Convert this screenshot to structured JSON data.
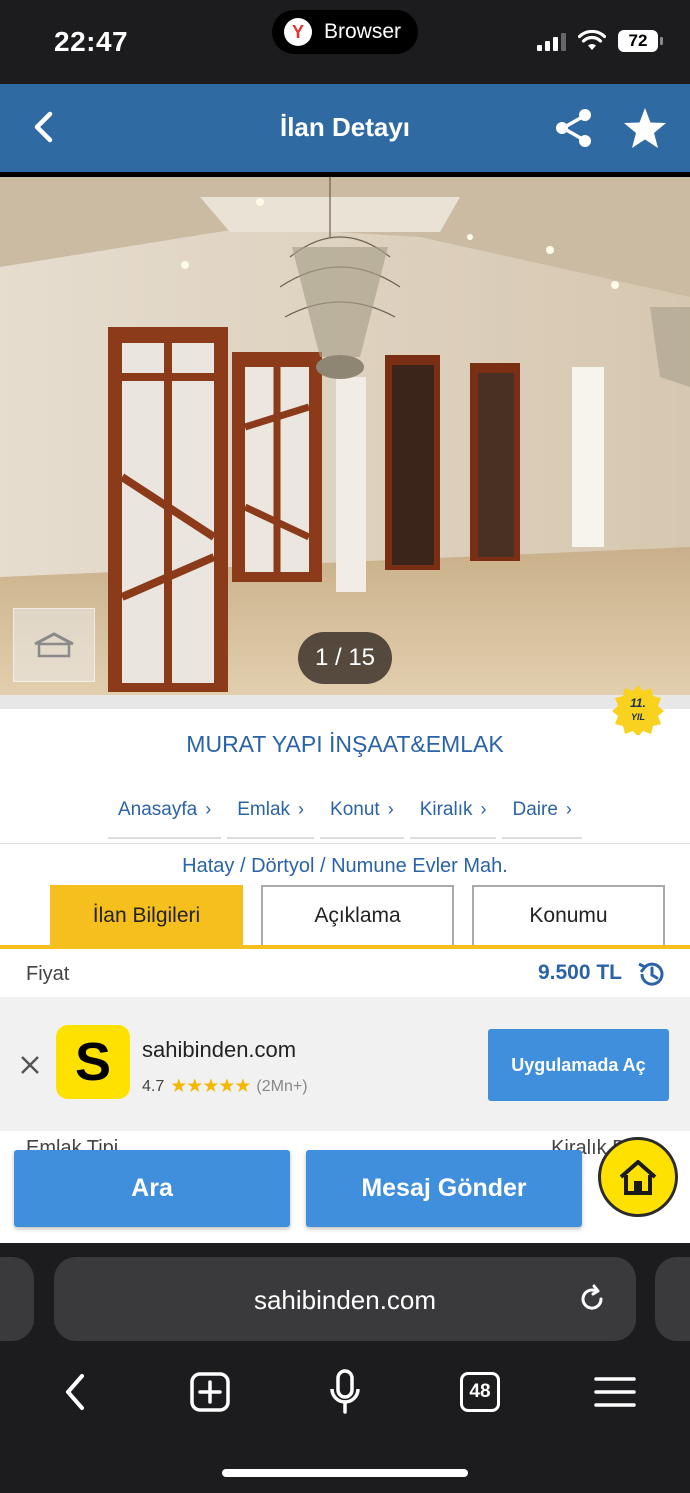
{
  "status_bar": {
    "time": "22:47",
    "app_label": "Browser",
    "battery": "72",
    "icons": [
      "signal-icon",
      "wifi-icon",
      "battery-icon"
    ]
  },
  "header": {
    "title": "İlan Detayı",
    "icons": [
      "back-chevron-icon",
      "share-icon",
      "star-icon"
    ]
  },
  "gallery": {
    "counter": "1 / 15"
  },
  "badge": {
    "years": "11.",
    "unit": "YIL"
  },
  "store": {
    "name": "MURAT YAPI İNŞAAT&EMLAK"
  },
  "breadcrumbs": [
    "Anasayfa",
    "Emlak",
    "Konut",
    "Kiralık",
    "Daire"
  ],
  "location": "Hatay / Dörtyol / Numune Evler Mah.",
  "tabs": [
    "İlan Bilgileri",
    "Açıklama",
    "Konumu"
  ],
  "active_tab": "İlan Bilgileri",
  "price": {
    "label": "Fiyat",
    "value": "9.500 TL"
  },
  "promo": {
    "logo_letter": "S",
    "name": "sahibinden.com",
    "rating": "4.7",
    "stars": "★★★★★",
    "count": "(2Mn+)",
    "button": "Uygulamada Aç"
  },
  "detail_row": {
    "label": "Emlak Tipi",
    "value": "Kiralık Daire"
  },
  "actions": {
    "search": "Ara",
    "message": "Mesaj Gönder"
  },
  "browser": {
    "url": "sahibinden.com",
    "tab_count": "48"
  },
  "colors": {
    "header_blue": "#2f6aa3",
    "link_blue": "#2b63a8",
    "button_blue": "#3f8fdc",
    "accent_yellow": "#f5c01e",
    "browser_dark": "#1c1c1e"
  }
}
